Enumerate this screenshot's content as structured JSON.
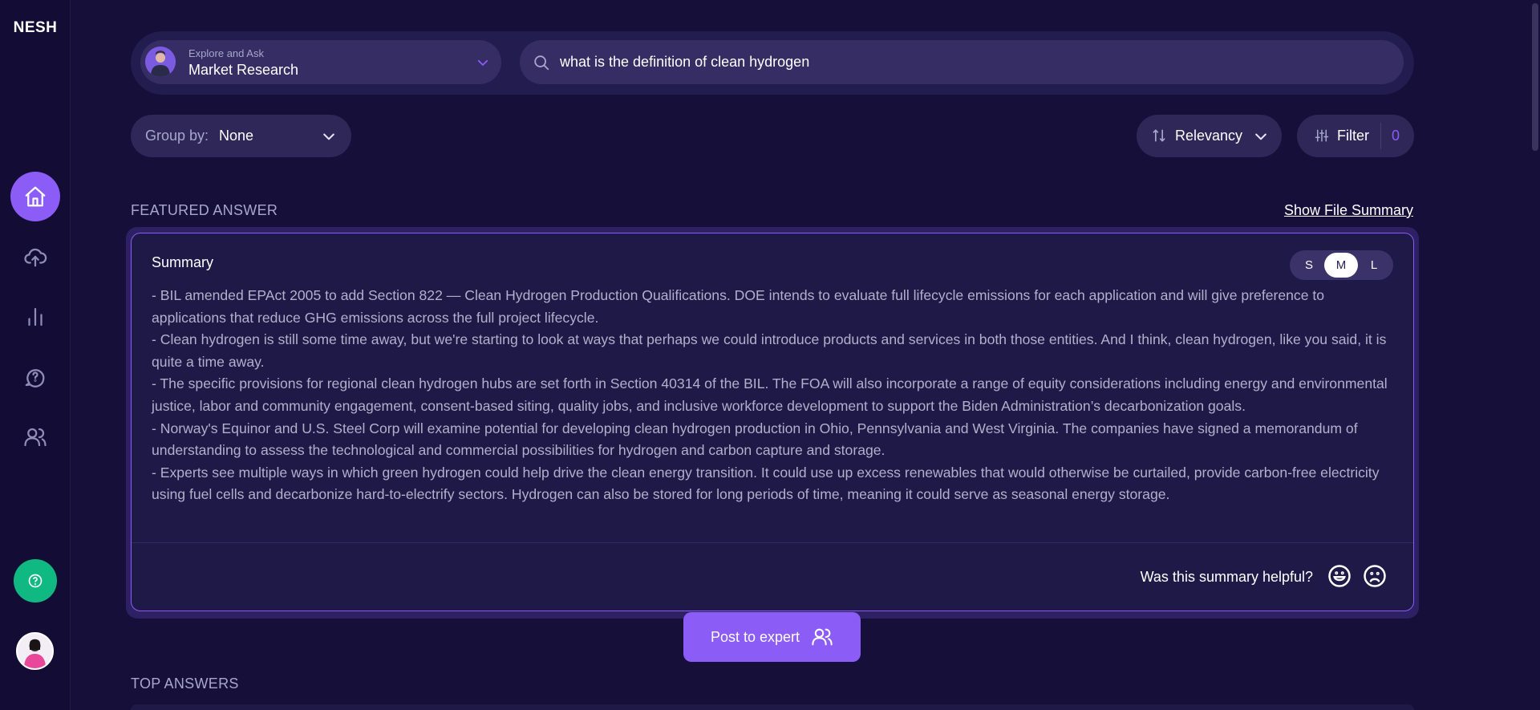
{
  "app": {
    "logo": "NESH"
  },
  "sidebar": {
    "items": [
      {
        "icon": "home-icon",
        "active": true
      },
      {
        "icon": "upload-cloud-icon",
        "active": false
      },
      {
        "icon": "bar-chart-icon",
        "active": false
      },
      {
        "icon": "question-chat-icon",
        "active": false
      },
      {
        "icon": "users-icon",
        "active": false
      }
    ],
    "help_icon": "help-circle-icon",
    "accent_color": "#8b5cf6",
    "help_color": "#10b981"
  },
  "search": {
    "context_small": "Explore and Ask",
    "context_main": "Market Research",
    "query": "what is the definition of clean hydrogen"
  },
  "controls": {
    "group_by_label": "Group by:",
    "group_by_value": "None",
    "sort_label": "Relevancy",
    "filter_label": "Filter",
    "filter_count": "0"
  },
  "featured": {
    "section_label": "FEATURED ANSWER",
    "show_file_summary": "Show File Summary",
    "card_title": "Summary",
    "sizes": [
      "S",
      "M",
      "L"
    ],
    "selected_size": "M",
    "summary_lines": [
      "- BIL amended EPAct 2005 to add Section 822 — Clean Hydrogen Production Qualifications. DOE intends to evaluate full lifecycle emissions for each application and will give preference to applications that reduce GHG emissions across the full project lifecycle.",
      "- Clean hydrogen is still some time away, but we're starting to look at ways that perhaps we could introduce products and services in both those entities. And I think, clean hydrogen, like you said, it is quite a time away.",
      "- The specific provisions for regional clean hydrogen hubs are set forth in Section 40314 of the BIL. The FOA will also incorporate a range of equity considerations including energy and environmental justice, labor and community engagement, consent-based siting, quality jobs, and inclusive workforce development to support the Biden Administration’s decarbonization goals.",
      "- Norway's Equinor and U.S. Steel Corp will examine potential for developing clean hydrogen production in Ohio, Pennsylvania and West Virginia. The companies have signed a memorandum of understanding to assess the technological and commercial possibilities for hydrogen and carbon capture and storage.",
      "- Experts see multiple ways in which green hydrogen could help drive the clean energy transition. It could use up excess renewables that would otherwise be curtailed, provide carbon-free electricity using fuel cells and decarbonize hard-to-electrify sectors. Hydrogen can also be stored for long periods of time, meaning it could serve as seasonal energy storage."
    ],
    "helpful_question": "Was this summary helpful?"
  },
  "post_expert_label": "Post to expert",
  "top_answers_label": "TOP ANSWERS"
}
